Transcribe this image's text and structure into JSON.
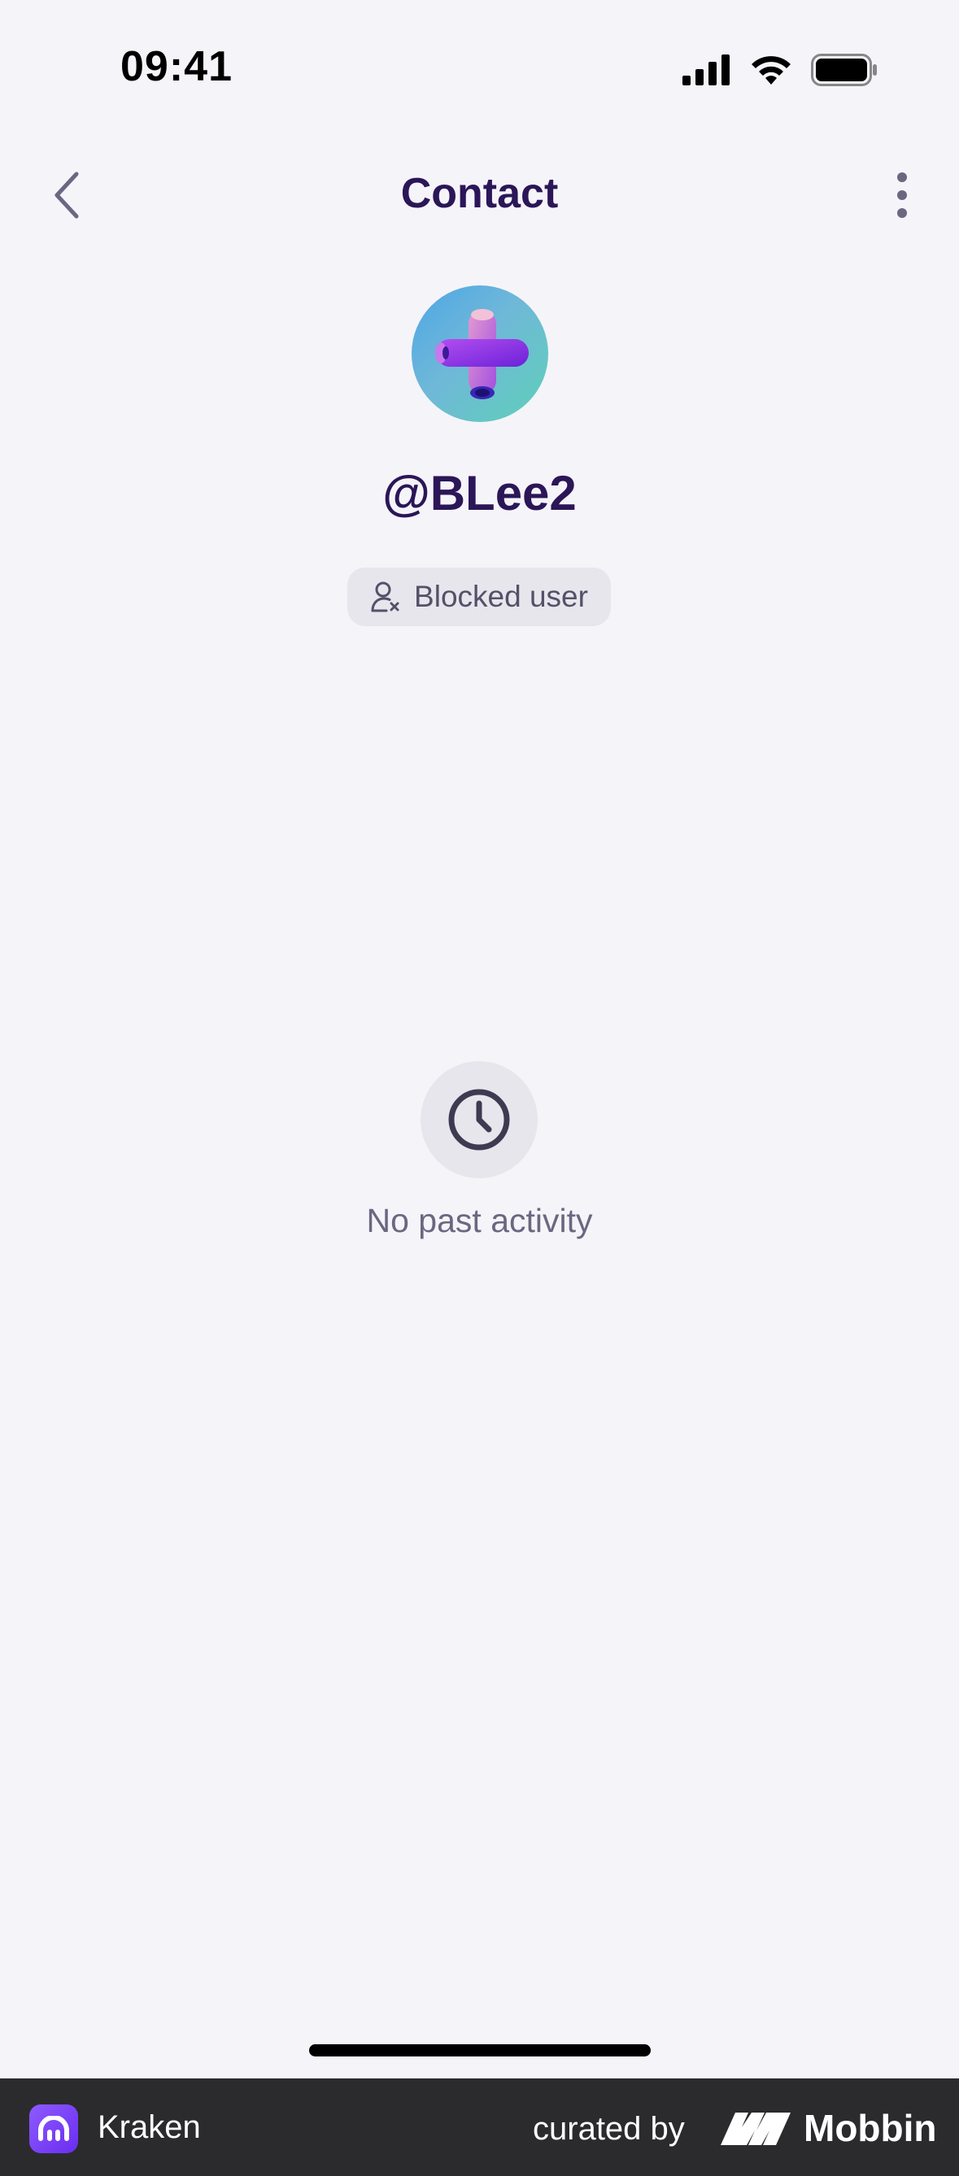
{
  "status_bar": {
    "time": "09:41",
    "icons": [
      "cellular-signal-icon",
      "wifi-icon",
      "battery-icon"
    ]
  },
  "nav": {
    "title": "Contact",
    "back_icon": "chevron-left-icon",
    "more_icon": "more-vertical-icon"
  },
  "profile": {
    "username": "@BLee2",
    "status_badge": "Blocked user",
    "status_icon": "user-blocked-icon"
  },
  "activity": {
    "empty_icon": "clock-icon",
    "empty_text": "No past activity"
  },
  "footer": {
    "app_name": "Kraken",
    "curated_by": "curated by",
    "brand": "Mobbin"
  },
  "colors": {
    "background": "#f5f4f9",
    "title": "#2b1657",
    "muted_text": "#6b6781",
    "badge_bg": "#e7e6ec",
    "footer_bg": "#2b2b2d",
    "kraken_purple": "#7a3ff5"
  }
}
